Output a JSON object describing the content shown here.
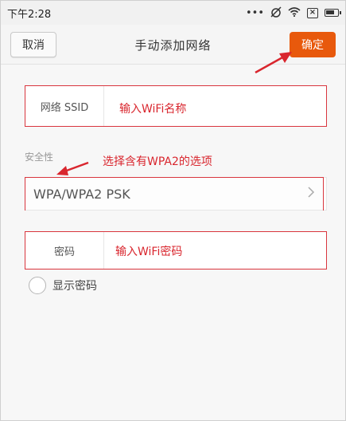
{
  "status_bar": {
    "time": "下午2:28",
    "icons": [
      "more-dots-icon",
      "alarm-muted-icon",
      "wifi-icon",
      "x-box-icon",
      "battery-icon"
    ]
  },
  "header": {
    "cancel_label": "取消",
    "title": "手动添加网络",
    "ok_label": "确定"
  },
  "form": {
    "ssid_label": "网络 SSID",
    "ssid_annotation": "输入WiFi名称",
    "security_label": "安全性",
    "security_annotation": "选择含有WPA2的选项",
    "security_value": "WPA/WPA2 PSK",
    "password_label": "密码",
    "password_annotation": "输入WiFi密码",
    "show_password_label": "显示密码"
  },
  "colors": {
    "accent": "#e8590c",
    "annotation": "#d9262e"
  }
}
